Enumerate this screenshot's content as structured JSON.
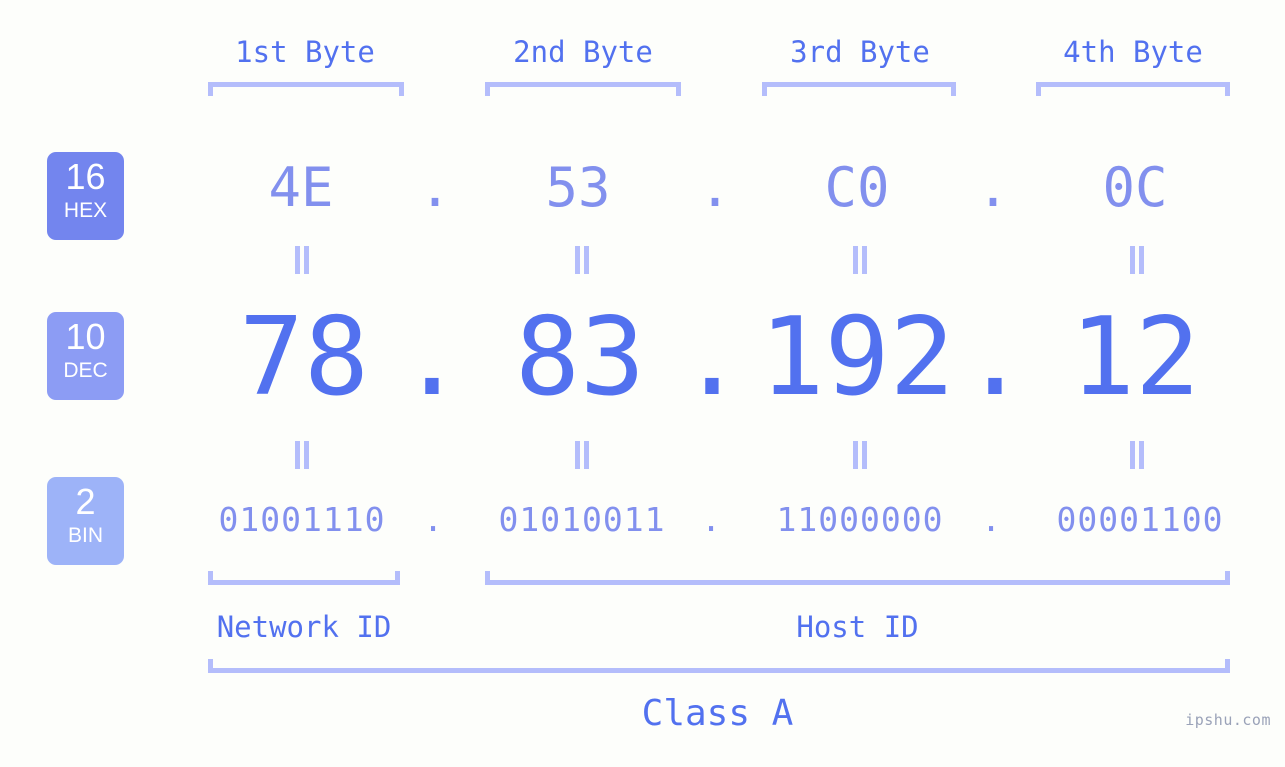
{
  "page": {
    "background_color": "#fdfefb",
    "accent_color": "#5271ef",
    "light_accent_color": "#8290ee",
    "bracket_color": "#b4bdfb"
  },
  "byte_headers": [
    {
      "label": "1st Byte"
    },
    {
      "label": "2nd Byte"
    },
    {
      "label": "3rd Byte"
    },
    {
      "label": "4th Byte"
    }
  ],
  "bases": [
    {
      "number": "16",
      "name": "HEX",
      "color": "#7385ee"
    },
    {
      "number": "10",
      "name": "DEC",
      "color": "#8c9cf4"
    },
    {
      "number": "2",
      "name": "BIN",
      "color": "#9db3f8"
    }
  ],
  "rows": {
    "hex": {
      "values": [
        "4E",
        "53",
        "C0",
        "0C"
      ],
      "separator": "."
    },
    "dec": {
      "values": [
        "78",
        "83",
        "192",
        "12"
      ],
      "separator": "."
    },
    "bin": {
      "values": [
        "01001110",
        "01010011",
        "11000000",
        "00001100"
      ],
      "separator": "."
    }
  },
  "equals_marker": "||",
  "id_sections": [
    {
      "label": "Network ID"
    },
    {
      "label": "Host ID"
    }
  ],
  "class_label": "Class A",
  "watermark": "ipshu.com"
}
